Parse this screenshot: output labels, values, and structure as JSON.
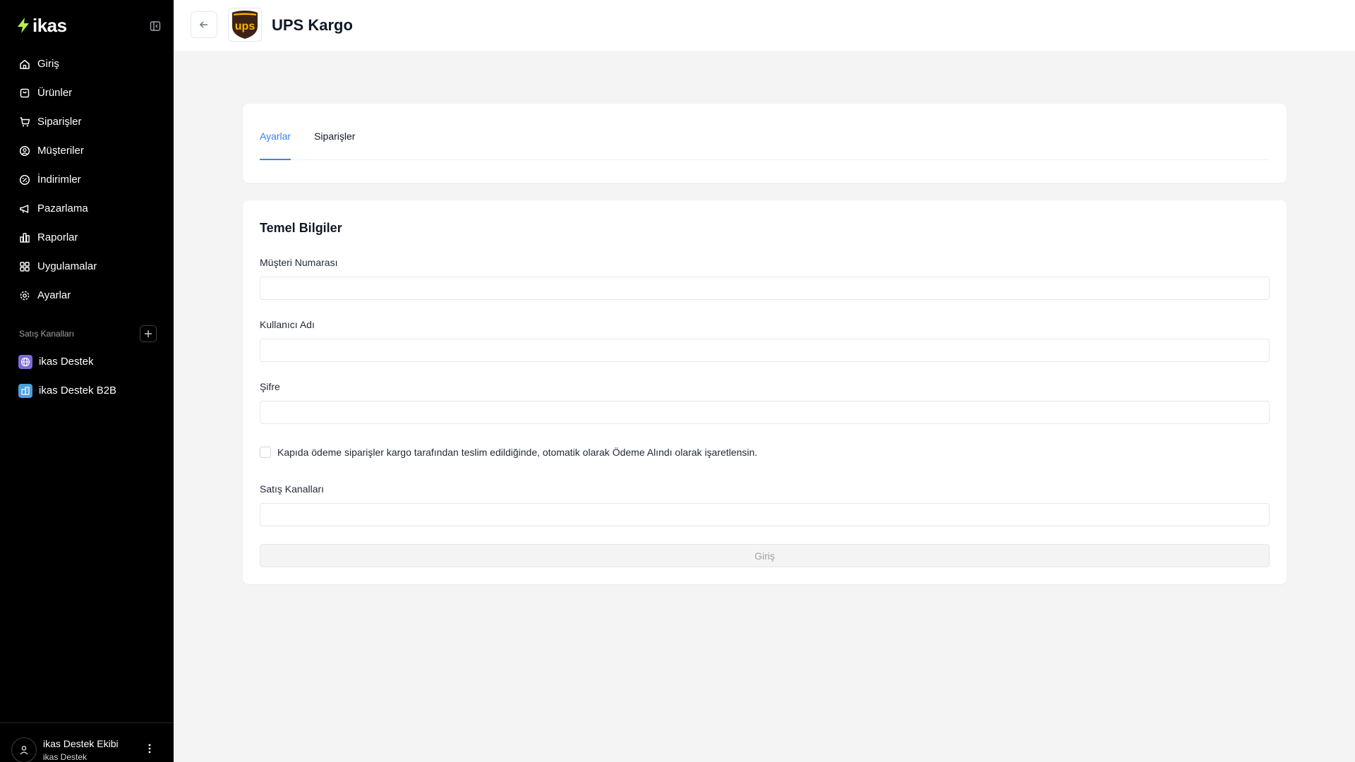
{
  "brand": {
    "name": "ikas",
    "accent": "#b5f04a"
  },
  "sidebar": {
    "items": [
      {
        "label": "Giriş",
        "icon": "home-icon"
      },
      {
        "label": "Ürünler",
        "icon": "box-icon"
      },
      {
        "label": "Siparişler",
        "icon": "cart-icon"
      },
      {
        "label": "Müşteriler",
        "icon": "user-circle-icon"
      },
      {
        "label": "İndirimler",
        "icon": "discount-icon"
      },
      {
        "label": "Pazarlama",
        "icon": "megaphone-icon"
      },
      {
        "label": "Raporlar",
        "icon": "chart-icon"
      },
      {
        "label": "Uygulamalar",
        "icon": "grid-icon"
      },
      {
        "label": "Ayarlar",
        "icon": "gear-icon"
      }
    ],
    "channels_title": "Satış Kanalları",
    "channels": [
      {
        "label": "ikas Destek",
        "icon": "globe-icon"
      },
      {
        "label": "ikas Destek B2B",
        "icon": "building-icon"
      }
    ],
    "user": {
      "name": "ikas Destek Ekibi",
      "store": "ikas Destek"
    }
  },
  "header": {
    "title": "UPS Kargo",
    "logo": "ups"
  },
  "tabs": [
    {
      "label": "Ayarlar",
      "active": true
    },
    {
      "label": "Siparişler",
      "active": false
    }
  ],
  "form": {
    "title": "Temel Bilgiler",
    "customer_number_label": "Müşteri Numarası",
    "customer_number_value": "",
    "username_label": "Kullanıcı Adı",
    "username_value": "",
    "password_label": "Şifre",
    "password_value": "",
    "cod_checkbox_label": "Kapıda ödeme siparişler kargo tarafından teslim edildiğinde, otomatik olarak Ödeme Alındı olarak işaretlensin.",
    "cod_checked": false,
    "sales_channels_label": "Satış Kanalları",
    "sales_channels_value": "",
    "submit_label": "Giriş"
  },
  "colors": {
    "tab_active": "#3b82f6",
    "sidebar_bg": "#000000",
    "page_bg": "#f4f4f5"
  }
}
